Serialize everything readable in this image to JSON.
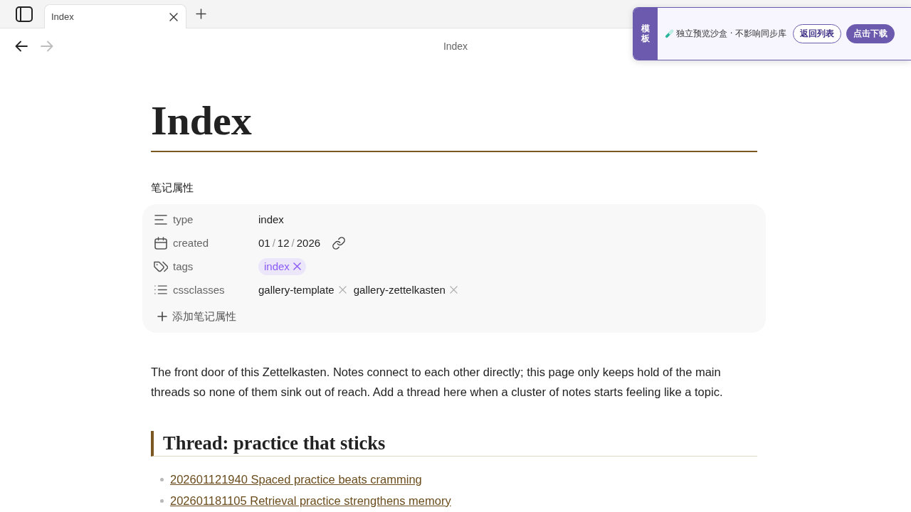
{
  "tab_bar": {
    "tabs": [
      {
        "label": "Index",
        "selected": true
      }
    ]
  },
  "nav": {
    "buttons": [
      {
        "kind": "back",
        "disabled": false
      },
      {
        "kind": "forward",
        "disabled": true
      }
    ],
    "title": "Index"
  },
  "note": {
    "title": "Index",
    "properties": {
      "heading": "笔记属性",
      "rows": [
        {
          "kind": "text",
          "name": "type",
          "value": "index"
        },
        {
          "kind": "date",
          "name": "created",
          "value": "01/12/2026"
        },
        {
          "kind": "tags",
          "name": "tags",
          "values": [
            "index"
          ]
        },
        {
          "kind": "list",
          "name": "cssclasses",
          "values": [
            "gallery-template",
            "gallery-zettelkasten"
          ]
        }
      ],
      "add_label": "添加笔记属性"
    },
    "paragraph": "The front door of this Zettelkasten. Notes connect to each other directly; this page only keeps hold of the main threads so none of them sink out of reach. Add a thread here when a cluster of notes starts feeling like a topic.",
    "sections": [
      {
        "heading": "Thread: practice that sticks",
        "links": [
          "202601121940 Spaced practice beats cramming",
          "202601181105 Retrieval practice strengthens memory"
        ]
      }
    ]
  },
  "banner": {
    "label": "模板",
    "message": "独立预览沙盒 · 不影响同步库",
    "buttons": [
      {
        "label": "返回列表",
        "kind": "outline"
      },
      {
        "label": "点击下载",
        "kind": "primary"
      }
    ]
  }
}
